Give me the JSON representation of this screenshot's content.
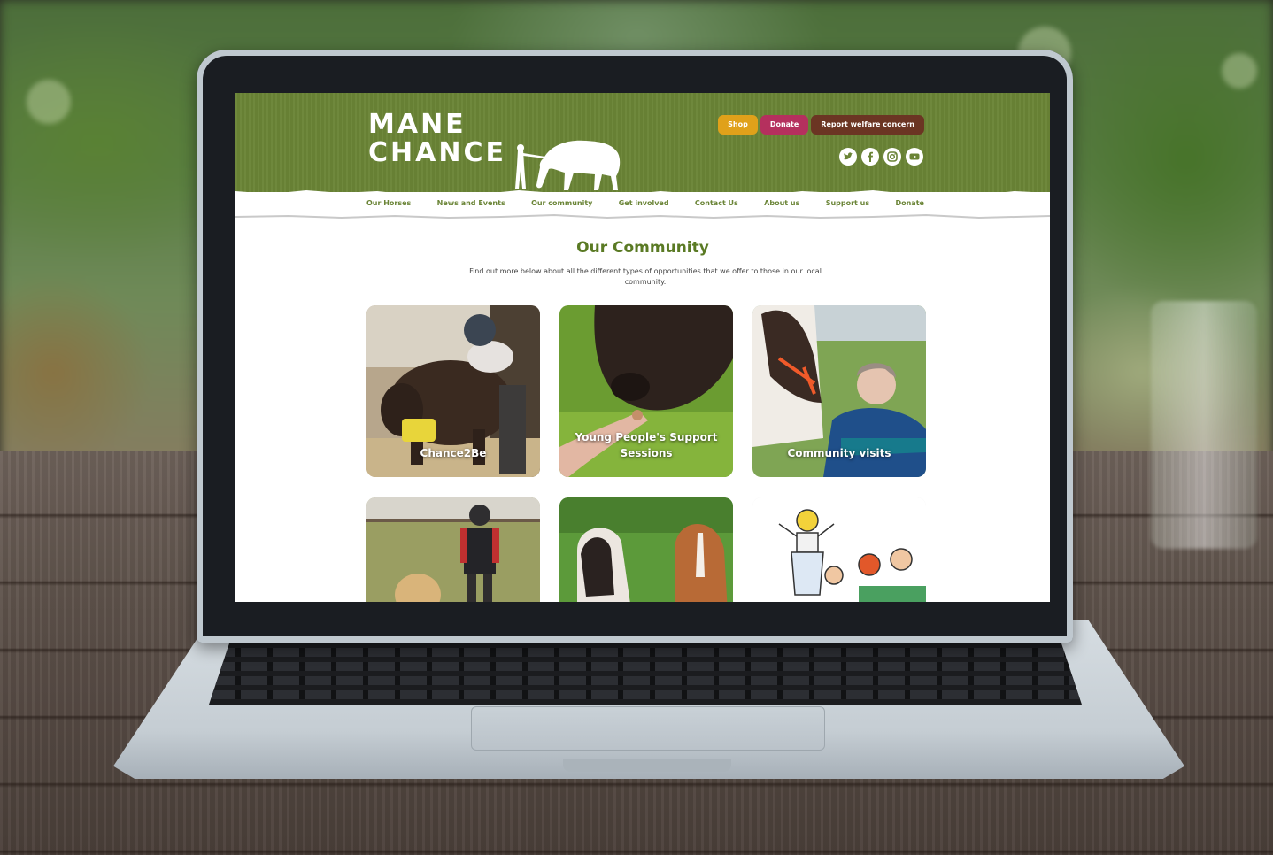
{
  "site": {
    "logo": {
      "line1": "MANE",
      "line2": "CHANCE"
    },
    "header_buttons": [
      {
        "label": "Shop",
        "color": "#e0a11a"
      },
      {
        "label": "Donate",
        "color": "#b5305e"
      },
      {
        "label": "Report welfare concern",
        "color": "#6b3523"
      }
    ],
    "social_icons": [
      "twitter-icon",
      "facebook-icon",
      "instagram-icon",
      "youtube-icon"
    ],
    "nav": [
      "Our Horses",
      "News and Events",
      "Our community",
      "Get involved",
      "Contact Us",
      "About us",
      "Support us",
      "Donate"
    ],
    "page_title": "Our Community",
    "intro": "Find out more below about all the different types of opportunities that we offer to those in our local community.",
    "cards": [
      {
        "label": "Chance2Be"
      },
      {
        "label": "Young People's Support Sessions"
      },
      {
        "label": "Community visits"
      },
      {
        "label": ""
      },
      {
        "label": ""
      },
      {
        "label": ""
      }
    ],
    "colors": {
      "brand_green": "#6a8436",
      "title_green": "#5a7a24"
    }
  }
}
